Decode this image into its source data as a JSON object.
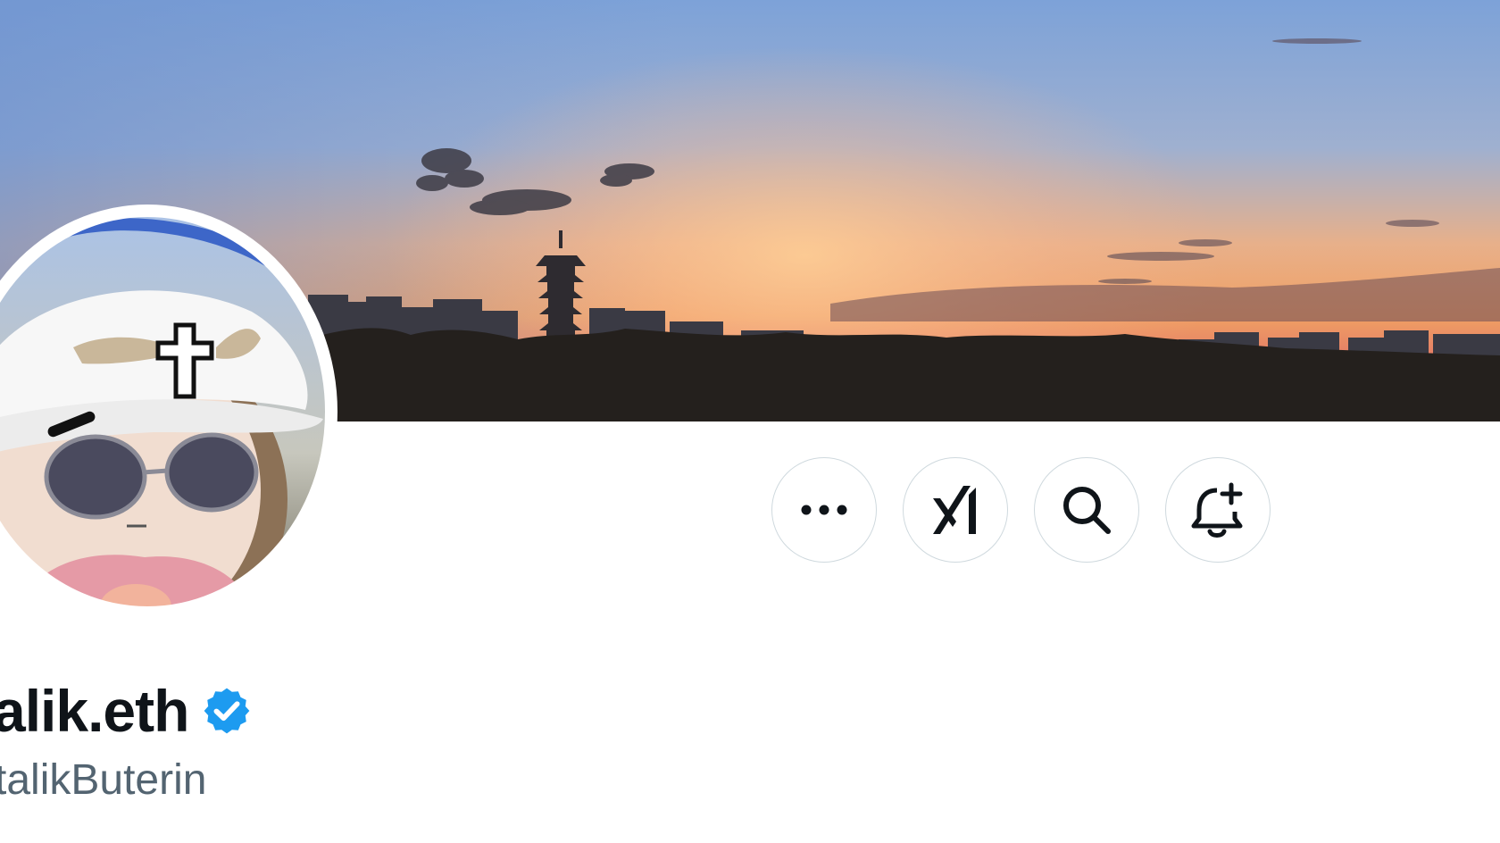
{
  "profile": {
    "display_name": "alik.eth",
    "handle": "talikButerin",
    "verified": true
  },
  "header": {
    "banner_description": "sunset skyline with pagoda",
    "actions": [
      {
        "icon": "more-icon"
      },
      {
        "icon": "grok-icon"
      },
      {
        "icon": "search-icon"
      },
      {
        "icon": "notification-bell-icon"
      }
    ]
  },
  "colors": {
    "name_text": "#0f1419",
    "handle_text": "#536471",
    "button_border": "#cfd9de",
    "verified_blue": "#1d9bf0",
    "sky_top": "#7a9fd6",
    "sky_horizon": "#f2a66e",
    "treeline": "#24201d"
  }
}
